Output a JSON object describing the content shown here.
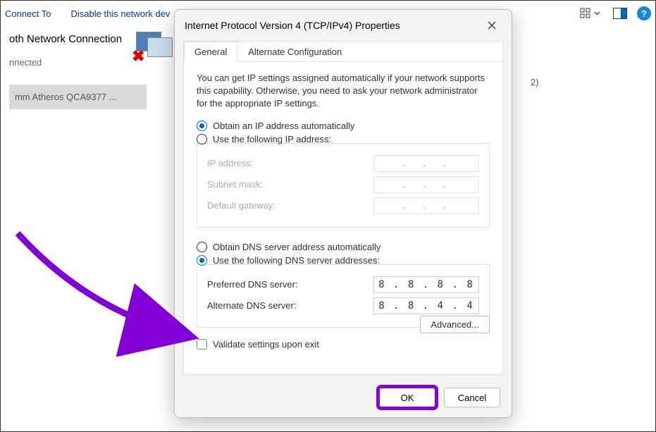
{
  "topbar": {
    "connect": "Connect To",
    "disable": "Disable this network dev"
  },
  "network": {
    "name": "oth Network Connection",
    "status": "nnected",
    "adapter": "mm Atheros QCA9377 ...",
    "count": "2)"
  },
  "dialog": {
    "title": "Internet Protocol Version 4 (TCP/IPv4) Properties",
    "tabs": {
      "general": "General",
      "alt": "Alternate Configuration"
    },
    "desc": "You can get IP settings assigned automatically if your network supports this capability. Otherwise, you need to ask your network administrator for the appropriate IP settings.",
    "ip": {
      "auto": "Obtain an IP address automatically",
      "manual": "Use the following IP address:",
      "addr_label": "IP address:",
      "mask_label": "Subnet mask:",
      "gw_label": "Default gateway:",
      "dots": ".     .     ."
    },
    "dns": {
      "auto": "Obtain DNS server address automatically",
      "manual": "Use the following DNS server addresses:",
      "pref_label": "Preferred DNS server:",
      "alt_label": "Alternate DNS server:",
      "pref_val": "8 . 8 . 8 . 8",
      "alt_val": "8 . 8 . 4 . 4"
    },
    "validate": "Validate settings upon exit",
    "advanced": "Advanced...",
    "ok": "OK",
    "cancel": "Cancel"
  }
}
